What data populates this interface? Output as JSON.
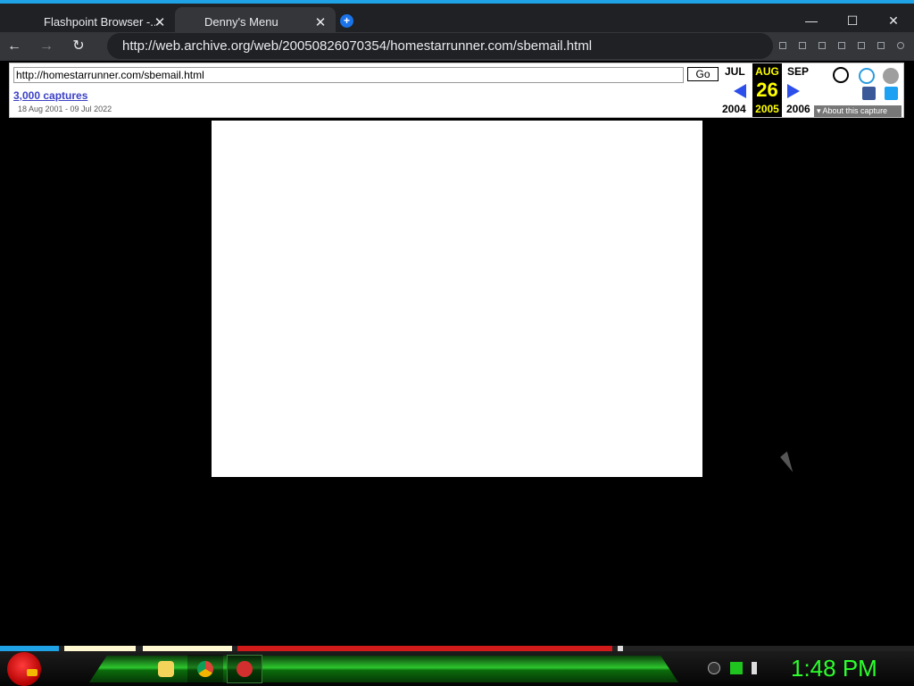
{
  "browser": {
    "tabs": [
      {
        "label": "Flashpoint Browser -...",
        "close": "✕"
      },
      {
        "label": "Denny's Menu",
        "close": "✕"
      }
    ],
    "new_tab": "+",
    "window_controls": {
      "minimize": "—",
      "maximize": "☐",
      "close": "✕"
    },
    "nav": {
      "back": "←",
      "forward": "→",
      "reload": "↻"
    },
    "address": "http://web.archive.org/web/20050826070354/homestarrunner.com/sbemail.html"
  },
  "wayback": {
    "url_value": "http://homestarrunner.com/sbemail.html",
    "go_label": "Go",
    "captures_link": "3,000 captures",
    "date_range": "18 Aug 2001 - 09 Jul 2022",
    "prev_month": "JUL",
    "prev_year": "2004",
    "current_month": "AUG",
    "current_day": "26",
    "current_year": "2005",
    "next_month": "SEP",
    "next_year": "2006",
    "about_label": "▾ About this capture",
    "colors": {
      "accent": "#ffff00",
      "arrow": "#2c4eea",
      "link": "#3c41c6"
    }
  },
  "taskbar": {
    "clock": "1:48 PM",
    "clock_color": "#2cff2c"
  }
}
